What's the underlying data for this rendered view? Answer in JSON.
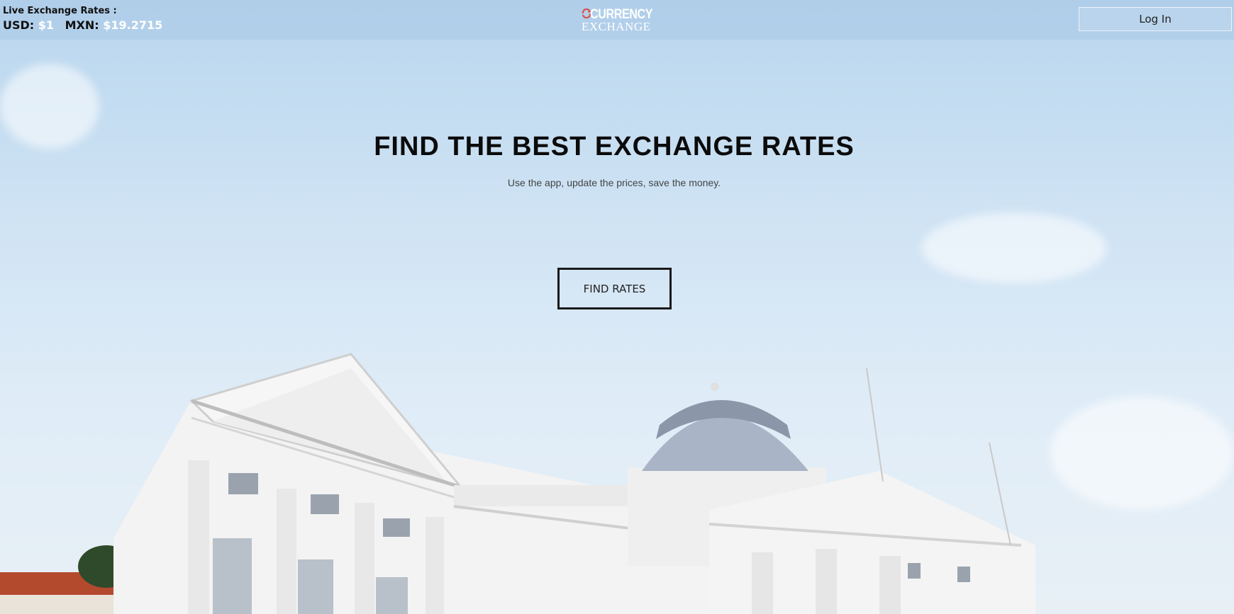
{
  "header": {
    "rates_title": "Live Exchange Rates :",
    "usd_label": "USD:",
    "usd_value": "$1",
    "mxn_label": "MXN:",
    "mxn_value": "$19.2715",
    "logo_top": "CURRENCY",
    "logo_bottom": "EXCHANGE",
    "login_label": "Log In"
  },
  "hero": {
    "title": "FIND THE BEST EXCHANGE RATES",
    "subtitle": "Use the app, update the prices, save the money.",
    "button_label": "FIND RATES"
  },
  "colors": {
    "logo_accent": "#d9534f",
    "sky": "#cfe2f3",
    "building": "#f2f2f2",
    "dome": "#a9b4c6"
  },
  "icons": {
    "logo_mark": "currency-exchange-logo-icon"
  }
}
